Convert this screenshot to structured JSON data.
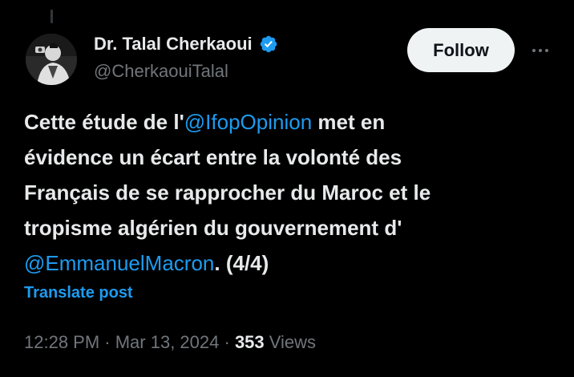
{
  "author": {
    "display_name": "Dr. Talal Cherkaoui",
    "handle": "@CherkaouiTalal",
    "verified_icon": "verified-badge-icon",
    "avatar_icon": "profile-photo"
  },
  "actions": {
    "follow_label": "Follow",
    "more_icon": "more-options-icon"
  },
  "tweet": {
    "line1_prefix": "Cette étude de l'",
    "mention1": "@IfopOpinion",
    "line1_suffix": " met en",
    "line2": "évidence un écart entre la volonté des",
    "line3": "Français de se rapprocher du Maroc et le",
    "line4": "tropisme algérien du gouvernement d'",
    "mention2": "@EmmanuelMacron",
    "line5_suffix": ". (4/4)"
  },
  "translate_label": "Translate post",
  "meta": {
    "time": "12:28 PM",
    "separator": " · ",
    "date": "Mar 13, 2024",
    "views_count": "353",
    "views_label": " Views"
  },
  "colors": {
    "background": "#000000",
    "text": "#e7e9ea",
    "secondary": "#71767b",
    "accent": "#1d9bf0",
    "button_bg": "#eff3f4"
  }
}
